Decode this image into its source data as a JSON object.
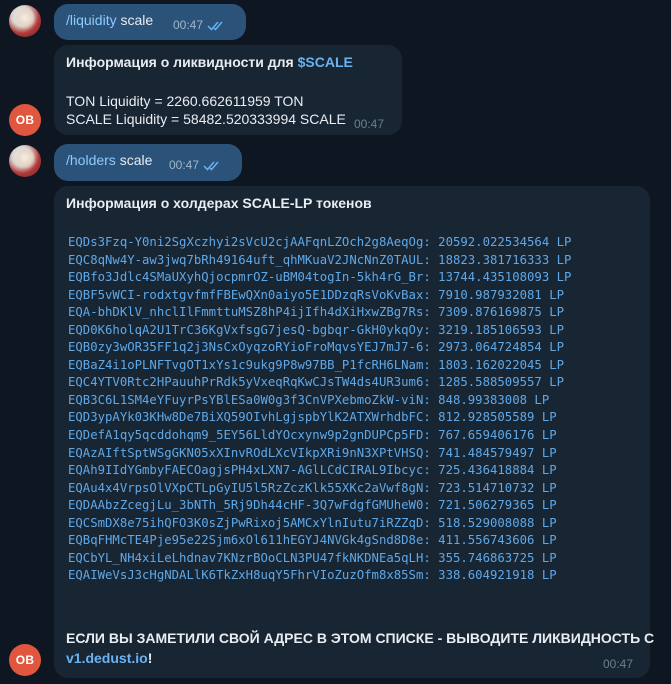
{
  "messages": {
    "cmd_liquidity": {
      "command": "/liquidity",
      "argument": "scale",
      "time": "00:47"
    },
    "liquidity_info": {
      "title_prefix": "Информация о ликвидности для ",
      "title_token": "$SCALE",
      "ton_liquidity": "TON Liquidity = 2260.662611959 TON",
      "scale_liquidity": "SCALE Liquidity = 58482.520333994 SCALE",
      "time": "00:47",
      "sender_initials": "OB"
    },
    "cmd_holders": {
      "command": "/holders",
      "argument": "scale",
      "time": "00:47"
    },
    "holders_info": {
      "title": "Информация о холдерах SCALE-LP токенов",
      "holders": [
        "EQDs3Fzq-Y0ni2SgXczhyi2sVcU2cjAAFqnLZOch2g8AeqOg: 20592.022534564 LP",
        "EQC8qNw4Y-aw3jwq7bRh49164uft_qhMKuaV2JNcNnZ0TAUL: 18823.381716333 LP",
        "EQBfo3Jdlc4SMaUXyhQjocpmrOZ-uBM04togIn-5kh4rG_Br: 13744.435108093 LP",
        "EQBF5vWCI-rodxtgvfmfFBEwQXn0aiyo5E1DDzqRsVoKvBax: 7910.987932081 LP",
        "EQA-bhDKlV_nhclIlFmmttuMSZ8hP4ijIfh4dXiHxwZBg7Rs: 7309.876169875 LP",
        "EQD0K6holqA2U1TrC36KgVxfsgG7jesQ-bgbqr-GkH0ykqOy: 3219.185106593 LP",
        "EQB0zy3wOR35FF1q2j3NsCxOyqzoRYioFroMqvsYEJ7mJ7-6: 2973.064724854 LP",
        "EQBaZ4i1oPLNFTvgOT1xYs1c9ukg9P8w97BB_P1fcRH6LNam: 1803.162022045 LP",
        "EQC4YTV0Rtc2HPauuhPrRdk5yVxeqRqKwCJsTW4ds4UR3um6: 1285.588509557 LP",
        "EQB3C6L1SM4eYFuyrPsYBlESa0W0g3f3CnVPXebmoZkW-viN: 848.99383008 LP",
        "EQD3ypAYk03KHw8De7BiXQ59OIvhLgjspbYlK2ATXWrhdbFC: 812.928505589 LP",
        "EQDefA1qy5qcddohqm9_5EY56LldYOcxynw9p2gnDUPCp5FD: 767.659406176 LP",
        "EQAzAIftSptWSgGKN05xXInvROdLXcVIkpXRi9nN3XPtVHSQ: 741.484579497 LP",
        "EQAh9IIdYGmbyFAECOagjsPH4xLXN7-AGlLCdCIRAL9Ibcyc: 725.436418884 LP",
        "EQAu4x4VrpsOlVXpCTLpGyIU5l5RzZczKlk55XKc2aVwf8gN: 723.514710732 LP",
        "EQDAAbzZcegjLu_3bNTh_5Rj9Dh44cHF-3Q7wFdgfGMUheW0: 721.506279365 LP",
        "EQCSmDX8e75ihQFO3K0sZjPwRixoj5AMCxYlnIutu7iRZZqD: 518.529008088 LP",
        "EQBqFHMcTE4Pje95e22Sjm6xOl611hEGYJ4NVGk4gSnd8D8e: 411.556743606 LP",
        "EQCbYL_NH4xiLeLhdnav7KNzrBOoCLN3PU47fkNKDNEa5qLH: 355.746863725 LP",
        "EQAIWeVsJ3cHgNDALlK6TkZxH8uqY5FhrVIoZuzOfm8x85Sm: 338.604921918 LP"
      ],
      "footer_text": "ЕСЛИ ВЫ ЗАМЕТИЛИ СВОЙ АДРЕС В ЭТОМ СПИСКЕ - ВЫВОДИТЕ ЛИКВИДНОСТЬ С",
      "footer_link": "v1.dedust.io",
      "footer_suffix": "!",
      "time": "00:47",
      "sender_initials": "OB"
    }
  }
}
